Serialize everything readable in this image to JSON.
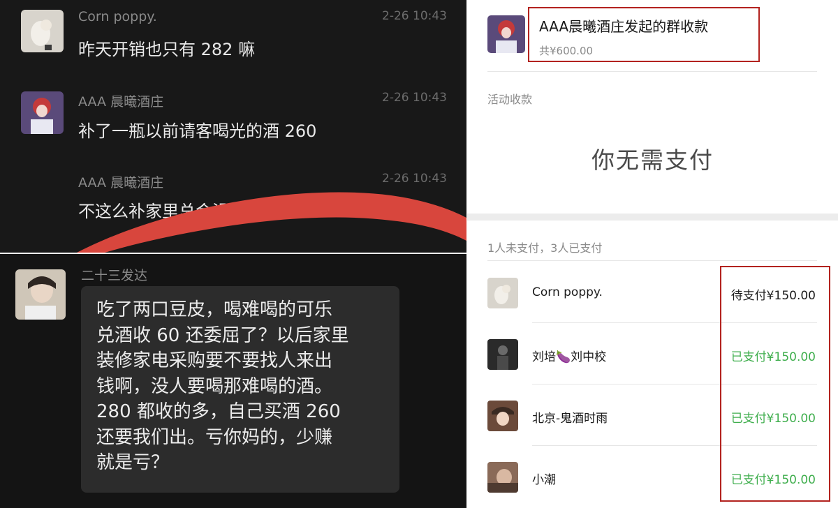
{
  "chat_top": {
    "messages": [
      {
        "sender": "Corn poppy.",
        "time": "2-26 10:43",
        "text": "昨天开销也只有 282 嘛"
      },
      {
        "sender": "AAA 晨曦酒庄",
        "time": "2-26 10:43",
        "text": "补了一瓶以前请客喝光的酒 260"
      },
      {
        "sender": "AAA 晨曦酒庄",
        "time": "2-26 10:43",
        "text": "不这么补家里总会没酒"
      }
    ]
  },
  "chat_bottom": {
    "sender": "二十三发达",
    "text": "吃了两口豆皮，喝难喝的可乐\n兑酒收 60 还委屈了？以后家里\n装修家电采购要不要找人来出\n钱啊，没人要喝那难喝的酒。\n280 都收的多，自己买酒 260\n还要我们出。亏你妈的，少赚\n就是亏？"
  },
  "payment": {
    "title": "AAA晨曦酒庄发起的群收款",
    "total": "共¥600.00",
    "section_label": "活动收款",
    "notice": "你无需支付",
    "summary": "1人未支付，3人已支付",
    "rows": [
      {
        "name": "Corn poppy.",
        "status": "待支付¥150.00"
      },
      {
        "name": "刘培🍆刘中校",
        "status": "已支付¥150.00"
      },
      {
        "name": "北京-鬼酒时雨",
        "status": "已支付¥150.00"
      },
      {
        "name": "小潮",
        "status": "已支付¥150.00"
      }
    ]
  },
  "colors": {
    "dark_bg": "#181818",
    "bubble_bg": "#2c2c2c",
    "annotation_red": "#b3231f",
    "paid_green": "#3fae4d",
    "pending_black": "#1c1c1c",
    "scribble_red": "#d8463d"
  },
  "icons": [
    "avatar-corn-poppy",
    "avatar-aaa",
    "avatar-ershisan",
    "avatar-liupei",
    "avatar-beijing",
    "avatar-xiaochao"
  ]
}
